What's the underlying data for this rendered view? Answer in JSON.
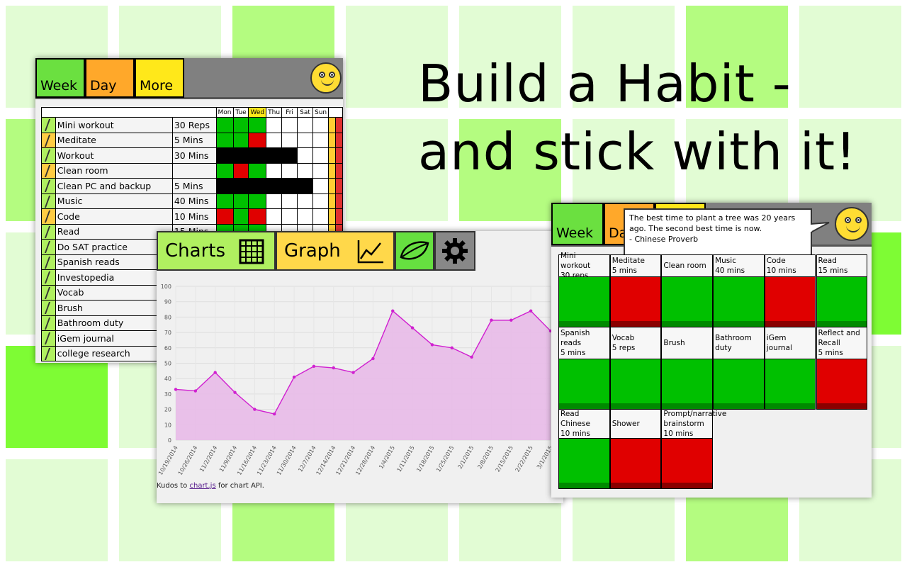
{
  "headline": {
    "line1": "Build a Habit -",
    "line2": "and stick with it!"
  },
  "colors": {
    "green": "#00c000",
    "red": "#e00000",
    "black": "#000000",
    "week_tab": "#6be040",
    "day_tab": "#ffa82a",
    "more_tab": "#ffe81a"
  },
  "habit_screen": {
    "tabs": {
      "week": "Week",
      "day": "Day",
      "more": "More"
    },
    "day_headers": [
      "Mon",
      "Tue",
      "Wed",
      "Thu",
      "Fri",
      "Sat",
      "Sun"
    ],
    "rows": [
      {
        "name": "Mini workout",
        "duration": "30 Reps",
        "days": [
          "green",
          "green",
          "green",
          "white",
          "white",
          "white",
          "white"
        ]
      },
      {
        "name": "Meditate",
        "duration": "5 Mins",
        "days": [
          "green",
          "green",
          "red",
          "white",
          "white",
          "white",
          "white"
        ]
      },
      {
        "name": "Workout",
        "duration": "30 Mins",
        "days": [
          "black",
          "black",
          "black",
          "black",
          "black",
          "white",
          "white"
        ]
      },
      {
        "name": "Clean room",
        "duration": "",
        "days": [
          "green",
          "red",
          "green",
          "white",
          "white",
          "white",
          "white"
        ]
      },
      {
        "name": "Clean PC and backup",
        "duration": "5 Mins",
        "days": [
          "black",
          "black",
          "black",
          "black",
          "black",
          "black",
          "white"
        ]
      },
      {
        "name": "Music",
        "duration": "40 Mins",
        "days": [
          "green",
          "green",
          "green",
          "white",
          "white",
          "white",
          "white"
        ]
      },
      {
        "name": "Code",
        "duration": "10 Mins",
        "days": [
          "red",
          "green",
          "red",
          "white",
          "white",
          "white",
          "white"
        ]
      },
      {
        "name": "Read",
        "duration": "15 Mins",
        "days": [
          "green",
          "green",
          "green",
          "white",
          "white",
          "white",
          "white"
        ]
      },
      {
        "name": "Do SAT practice",
        "duration": "",
        "days": [
          "white",
          "white",
          "white",
          "white",
          "white",
          "white",
          "white"
        ]
      },
      {
        "name": "Spanish reads",
        "duration": "",
        "days": [
          "white",
          "white",
          "white",
          "white",
          "white",
          "white",
          "white"
        ]
      },
      {
        "name": "Investopedia",
        "duration": "",
        "days": [
          "white",
          "white",
          "white",
          "white",
          "white",
          "white",
          "white"
        ]
      },
      {
        "name": "Vocab",
        "duration": "",
        "days": [
          "white",
          "white",
          "white",
          "white",
          "white",
          "white",
          "white"
        ]
      },
      {
        "name": "Brush",
        "duration": "",
        "days": [
          "white",
          "white",
          "white",
          "white",
          "white",
          "white",
          "white"
        ]
      },
      {
        "name": "Bathroom duty",
        "duration": "",
        "days": [
          "white",
          "white",
          "white",
          "white",
          "white",
          "white",
          "white"
        ]
      },
      {
        "name": "iGem journal",
        "duration": "",
        "days": [
          "white",
          "white",
          "white",
          "white",
          "white",
          "white",
          "white"
        ]
      },
      {
        "name": "college research",
        "duration": "",
        "days": [
          "white",
          "white",
          "white",
          "white",
          "white",
          "white",
          "white"
        ]
      }
    ]
  },
  "charts_screen": {
    "tabs": {
      "charts": "Charts",
      "graph": "Graph"
    },
    "note_prefix": "Kudos to ",
    "note_link": "chart.js",
    "note_suffix": " for chart API."
  },
  "chart_data": {
    "type": "area",
    "x": [
      "10/19/2014",
      "10/26/2014",
      "11/2/2014",
      "11/9/2014",
      "11/16/2014",
      "11/23/2014",
      "11/30/2014",
      "12/7/2014",
      "12/14/2014",
      "12/21/2014",
      "12/28/2014",
      "1/4/2015",
      "1/11/2015",
      "1/18/2015",
      "1/25/2015",
      "2/1/2015",
      "2/8/2015",
      "2/15/2015",
      "2/22/2015",
      "3/1/2015"
    ],
    "values": [
      33,
      32,
      44,
      31,
      20,
      17,
      41,
      48,
      47,
      44,
      53,
      84,
      73,
      62,
      60,
      54,
      78,
      78,
      84,
      71
    ],
    "ylim": [
      0,
      100
    ],
    "yticks": [
      0,
      10,
      20,
      30,
      40,
      50,
      60,
      70,
      80,
      90,
      100
    ],
    "grid": true,
    "color": "#d020d0"
  },
  "overview_screen": {
    "tabs": {
      "week": "Week",
      "day": "Da"
    },
    "quote": {
      "line1": "The best time to plant a tree was 20 years",
      "line2": "ago. The second best time is now.",
      "line3": "- Chinese Proverb"
    },
    "cells": [
      {
        "label1": "Mini workout",
        "label2": "30 reps",
        "status": "green"
      },
      {
        "label1": "Meditate",
        "label2": "5 mins",
        "status": "red"
      },
      {
        "label1": "Clean room",
        "label2": "",
        "status": "green"
      },
      {
        "label1": "Music",
        "label2": "40 mins",
        "status": "green"
      },
      {
        "label1": "Code",
        "label2": "10 mins",
        "status": "red"
      },
      {
        "label1": "Read",
        "label2": "15 mins",
        "status": "green"
      },
      {
        "label1": "Spanish reads",
        "label2": "5 mins",
        "status": "green"
      },
      {
        "label1": "Vocab",
        "label2": "5 reps",
        "status": "green"
      },
      {
        "label1": "Brush",
        "label2": "",
        "status": "green"
      },
      {
        "label1": "Bathroom duty",
        "label2": "",
        "status": "green"
      },
      {
        "label1": "iGem journal",
        "label2": "",
        "status": "green"
      },
      {
        "label1": "Reflect and Recall",
        "label2": "5 mins",
        "status": "red"
      },
      {
        "label1": "Read Chinese",
        "label2": "10 mins",
        "status": "green"
      },
      {
        "label1": "Shower",
        "label2": "",
        "status": "red"
      },
      {
        "label1": "Prompt/narrative brainstorm",
        "label2": "10 mins",
        "status": "red"
      }
    ]
  }
}
